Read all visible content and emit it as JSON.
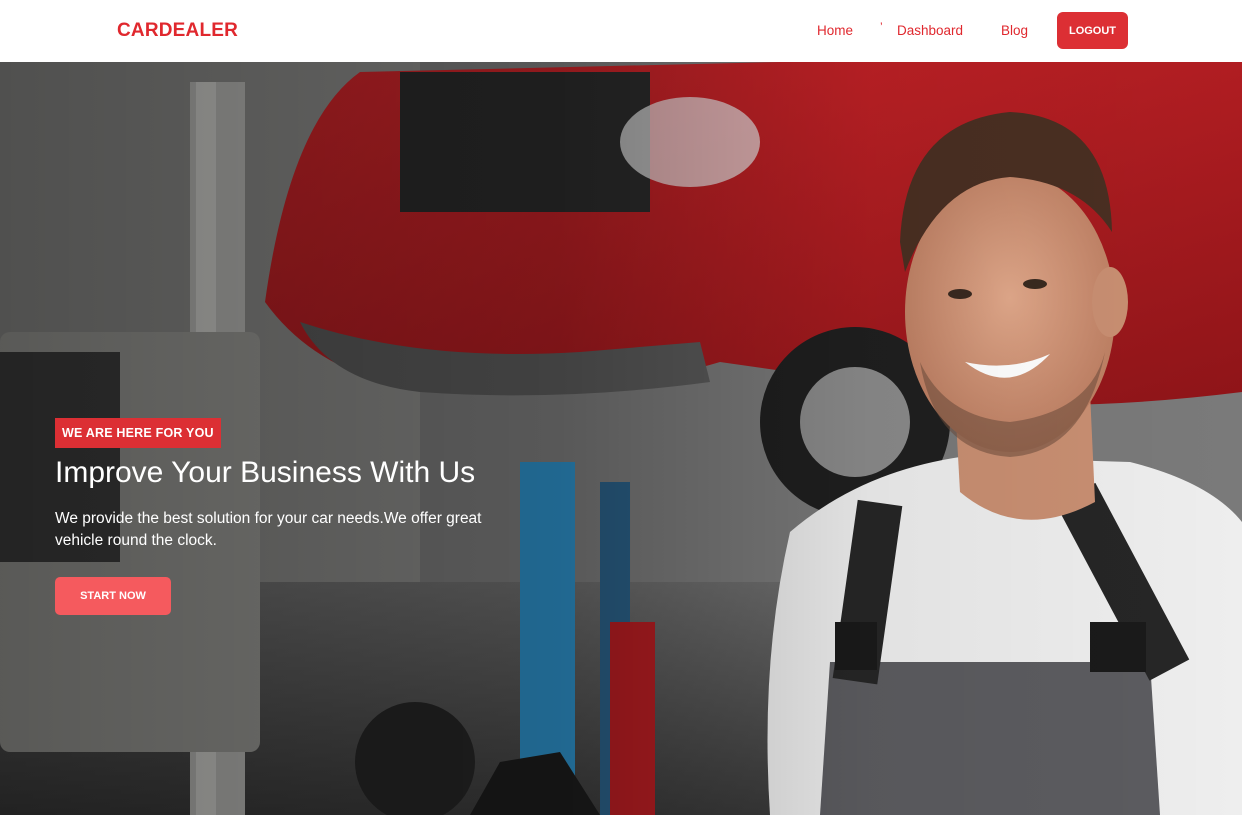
{
  "navbar": {
    "brand": "CARDEALER",
    "links": [
      {
        "label": "Home"
      },
      {
        "label": "Dashboard"
      },
      {
        "label": "Blog"
      }
    ],
    "tick": "’",
    "logout_label": "LOGOUT"
  },
  "hero": {
    "tagline": "WE ARE HERE FOR YOU",
    "headline": "Improve Your Business With Us",
    "subtext": "We provide the best solution for your car needs.We offer great vehicle round the clock.",
    "cta_label": "START NOW"
  },
  "colors": {
    "brand_red": "#e0282e",
    "button_red": "#dc2f34",
    "cta_coral": "#f55a5e",
    "navbar_bg": "#ffffff"
  }
}
